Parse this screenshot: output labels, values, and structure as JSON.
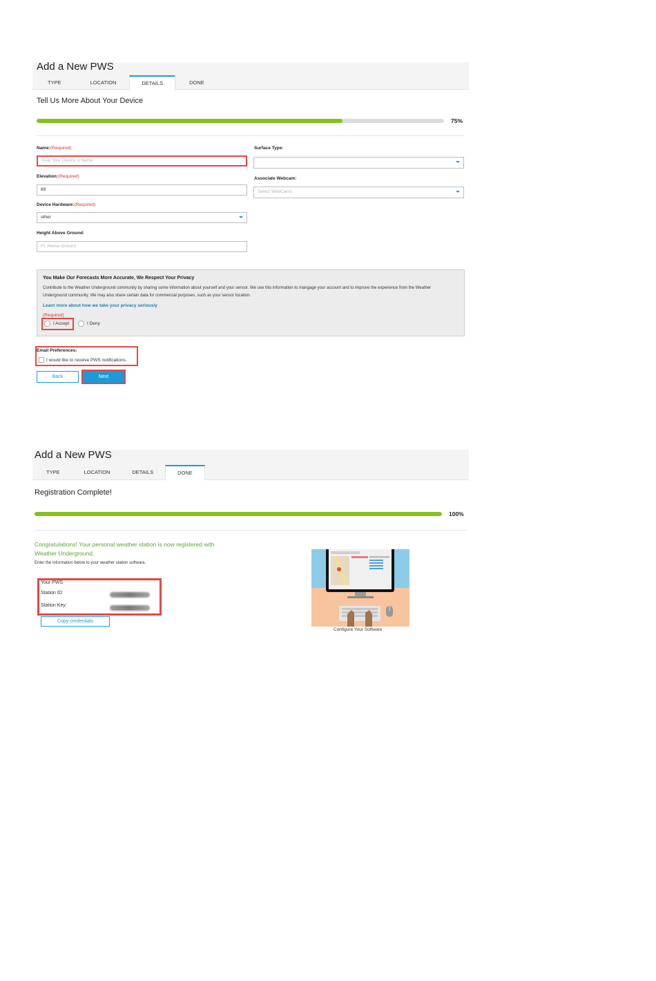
{
  "panel1": {
    "title": "Add a New PWS",
    "tabs": [
      "TYPE",
      "LOCATION",
      "DETAILS",
      "DONE"
    ],
    "active_tab": "DETAILS",
    "section_title": "Tell Us More About Your Device",
    "progress": {
      "value": 75,
      "label": "75%"
    },
    "fields": {
      "name_label": "Name:",
      "name_required": "(Required)",
      "name_placeholder": "Give Your Device a Name",
      "elevation_label": "Elevation:",
      "elevation_required": "(Required)",
      "elevation_value": "89",
      "hardware_label": "Device Hardware:",
      "hardware_required": "(Required)",
      "hardware_value": "other",
      "height_label": "Height Above Ground:",
      "height_placeholder": "Ft. Above Ground",
      "surface_label": "Surface Type:",
      "surface_value": "",
      "webcam_label": "Associate Webcam:",
      "webcam_placeholder": "Select WebCams"
    },
    "privacy": {
      "title": "You Make Our Forecasts More Accurate, We Respect Your Privacy",
      "text": "Contribute to the Weather Underground community by sharing some information about yourself and your sensor. We use this information to mangage your account and to improve the experience from the Weather Underground community. We may also share certain data for commercial purposes, such as your sensor location.",
      "link": "Learn more about how we take your privacy seriously",
      "required": "(Required)",
      "accept": "I Accept",
      "deny": "I Deny"
    },
    "email": {
      "title": "Email Preferences:",
      "checkbox_label": "I would like to receive PWS notifications."
    },
    "buttons": {
      "back": "Back",
      "next": "Next"
    }
  },
  "panel2": {
    "title": "Add a New PWS",
    "tabs": [
      "TYPE",
      "LOCATION",
      "DETAILS",
      "DONE"
    ],
    "active_tab": "DONE",
    "section_title": "Registration Complete!",
    "progress": {
      "value": 100,
      "label": "100%"
    },
    "congrats_line1": "Congratulations! Your personal weather station is now registered with",
    "congrats_line2": "Weather Underground.",
    "instructions": "Enter the information below to your weather station software.",
    "cred_title": "Your PWS",
    "station_id_label": "Station ID:",
    "station_key_label": "Station Key:",
    "copy_button": "Copy credentials",
    "illustration_caption": "Configure Your Software"
  },
  "colors": {
    "accent": "#1a9bd7",
    "progress": "#86c01c",
    "error": "#e04848",
    "success_text": "#5aa632"
  }
}
